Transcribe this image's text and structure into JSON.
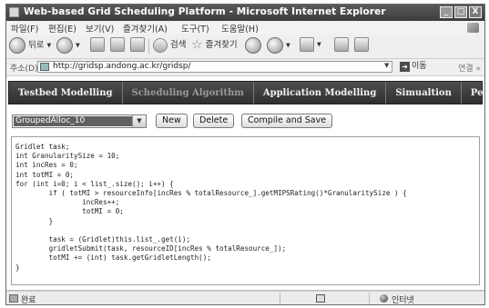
{
  "window": {
    "title": "Web-based Grid Scheduling Platform - Microsoft Internet Explorer",
    "controls": [
      "_",
      "□",
      "X"
    ]
  },
  "menubar": {
    "items": [
      "파일(F)",
      "편집(E)",
      "보기(V)",
      "즐겨찾기(A)",
      "도구(T)",
      "도움말(H)"
    ]
  },
  "toolbar": {
    "back_label": "뒤로",
    "search_label": "검색",
    "favorites_label": "즐겨찾기"
  },
  "addressbar": {
    "label": "주소(D)",
    "url": "http://gridsp.andong.ac.kr/gridsp/",
    "go_label": "이동",
    "links_label": "연결"
  },
  "nav": {
    "tabs": [
      {
        "label": "Testbed Modelling",
        "active": false
      },
      {
        "label": "Scheduling Algorithm",
        "active": true
      },
      {
        "label": "Application Modelling",
        "active": false
      },
      {
        "label": "Simualtion",
        "active": false
      },
      {
        "label": "Performance",
        "active": false
      }
    ]
  },
  "controls": {
    "algorithm_select": "GroupedAlloc_10",
    "new_label": "New",
    "delete_label": "Delete",
    "compile_label": "Compile and Save"
  },
  "code": "Gridlet task;\nint GranularitySize = 10;\nint incRes = 0;\nint totMI = 0;\nfor (int i=0; i < list_.size(); i++) {\n        if ( totMI > resourceInfo[incRes % totalResource_].getMIPSRating()*GranularitySize ) {\n                incRes++;\n                totMI = 0;\n        }\n\n        task = (Gridlet)this.list_.get(i);\n        gridletSubmit(task, resourceID[incRes % totalResource_]);\n        totMI += (int) task.getGridletLength();\n}",
  "statusbar": {
    "status_text": "완료",
    "zone_text": "인터넷"
  },
  "icons": {
    "app": "ie-logo-icon",
    "back": "back-arrow-icon",
    "forward": "forward-arrow-icon",
    "stop": "stop-icon",
    "refresh": "refresh-icon",
    "home": "home-icon",
    "search": "search-icon",
    "favorites": "star-icon",
    "history": "history-icon",
    "mail": "mail-icon",
    "print": "print-icon"
  }
}
